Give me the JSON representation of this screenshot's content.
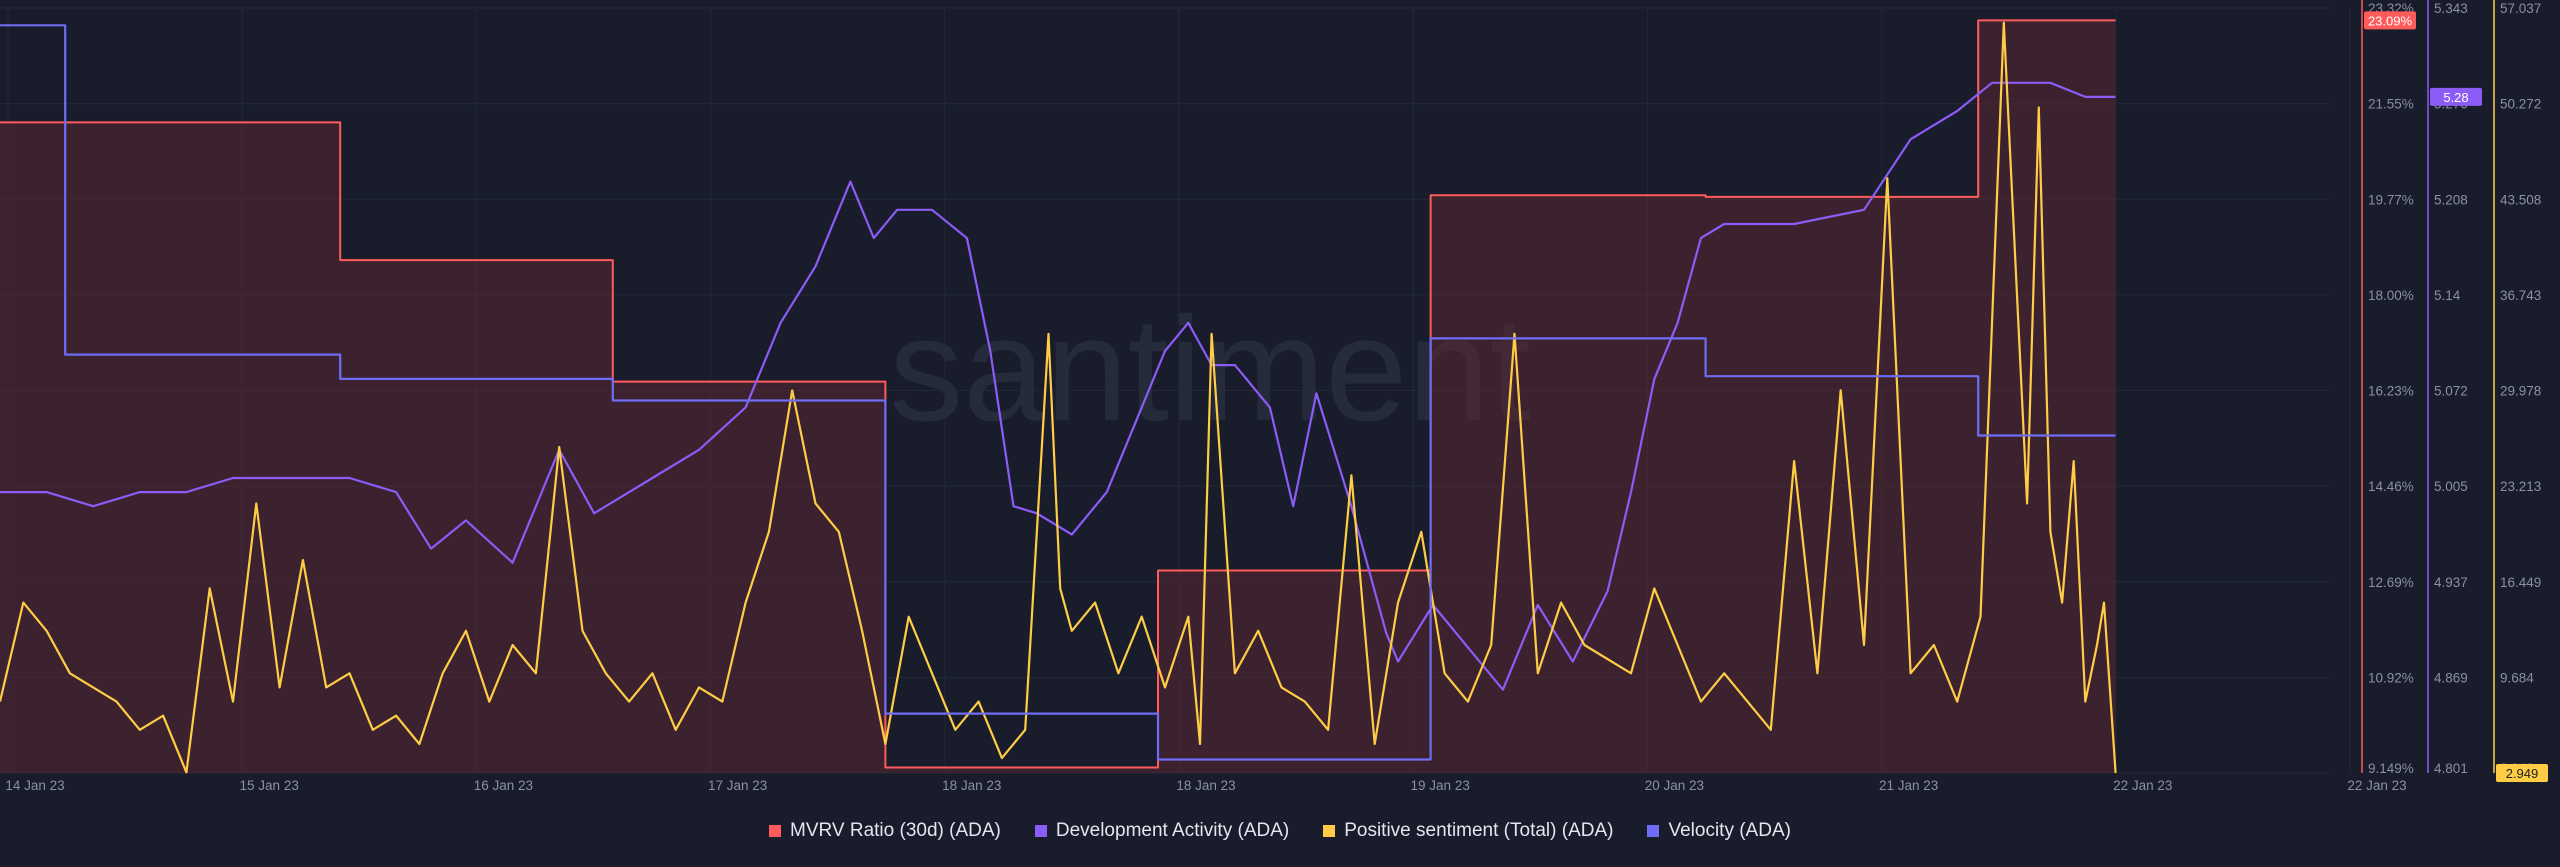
{
  "watermark": "santiment",
  "chart_data": {
    "type": "line",
    "x_labels": [
      "14 Jan 23",
      "15 Jan 23",
      "16 Jan 23",
      "17 Jan 23",
      "18 Jan 23",
      "18 Jan 23",
      "19 Jan 23",
      "20 Jan 23",
      "21 Jan 23",
      "22 Jan 23",
      "22 Jan 23"
    ],
    "axes": {
      "mvrv": {
        "ticks": [
          "23.32%",
          "21.55%",
          "19.77%",
          "18.00%",
          "16.23%",
          "14.46%",
          "12.69%",
          "10.92%",
          "9.149%"
        ],
        "range": [
          9.149,
          23.32
        ],
        "badge": "23.09%",
        "color": "#ff5b5b"
      },
      "dev": {
        "ticks": [
          "5.343",
          "5.276",
          "5.208",
          "5.14",
          "5.072",
          "5.005",
          "4.937",
          "4.869",
          "4.801"
        ],
        "range": [
          4.801,
          5.343
        ],
        "badge": "5.28",
        "color": "#8b5cf6"
      },
      "sent": {
        "ticks": [
          "57.037",
          "50.272",
          "43.508",
          "36.743",
          "29.978",
          "23.213",
          "16.449",
          "9.684",
          "2.949"
        ],
        "range": [
          2.949,
          57.037
        ],
        "badge": "2.949",
        "color": "#ffcd45"
      }
    },
    "series": [
      {
        "name": "MVRV Ratio (30d) (ADA)",
        "color": "#ff5b5b",
        "axis": "mvrv",
        "type": "area",
        "points": [
          [
            0,
            21.2
          ],
          [
            0.146,
            21.2
          ],
          [
            0.146,
            18.65
          ],
          [
            0.263,
            18.65
          ],
          [
            0.263,
            16.4
          ],
          [
            0.38,
            16.4
          ],
          [
            0.38,
            9.25
          ],
          [
            0.497,
            9.25
          ],
          [
            0.497,
            12.9
          ],
          [
            0.614,
            12.9
          ],
          [
            0.614,
            19.85
          ],
          [
            0.732,
            19.85
          ],
          [
            0.732,
            19.82
          ],
          [
            0.849,
            19.82
          ],
          [
            0.849,
            23.09
          ],
          [
            0.908,
            23.09
          ]
        ]
      },
      {
        "name": "Development Activity (ADA)",
        "color": "#8b5cf6",
        "axis": "dev",
        "type": "line",
        "points": [
          [
            0,
            5.0
          ],
          [
            0.02,
            5.0
          ],
          [
            0.04,
            4.99
          ],
          [
            0.06,
            5.0
          ],
          [
            0.08,
            5.0
          ],
          [
            0.1,
            5.01
          ],
          [
            0.13,
            5.01
          ],
          [
            0.15,
            5.01
          ],
          [
            0.17,
            5.0
          ],
          [
            0.185,
            4.96
          ],
          [
            0.2,
            4.98
          ],
          [
            0.22,
            4.95
          ],
          [
            0.24,
            5.03
          ],
          [
            0.255,
            4.985
          ],
          [
            0.28,
            5.01
          ],
          [
            0.3,
            5.03
          ],
          [
            0.32,
            5.06
          ],
          [
            0.335,
            5.12
          ],
          [
            0.35,
            5.16
          ],
          [
            0.365,
            5.22
          ],
          [
            0.375,
            5.18
          ],
          [
            0.385,
            5.2
          ],
          [
            0.4,
            5.2
          ],
          [
            0.415,
            5.18
          ],
          [
            0.425,
            5.1
          ],
          [
            0.435,
            4.99
          ],
          [
            0.445,
            4.985
          ],
          [
            0.46,
            4.97
          ],
          [
            0.475,
            5.0
          ],
          [
            0.49,
            5.06
          ],
          [
            0.5,
            5.1
          ],
          [
            0.51,
            5.12
          ],
          [
            0.52,
            5.09
          ],
          [
            0.53,
            5.09
          ],
          [
            0.545,
            5.06
          ],
          [
            0.555,
            4.99
          ],
          [
            0.565,
            5.07
          ],
          [
            0.58,
            4.99
          ],
          [
            0.595,
            4.9
          ],
          [
            0.6,
            4.88
          ],
          [
            0.615,
            4.92
          ],
          [
            0.63,
            4.89
          ],
          [
            0.645,
            4.86
          ],
          [
            0.66,
            4.92
          ],
          [
            0.675,
            4.88
          ],
          [
            0.69,
            4.93
          ],
          [
            0.7,
            5.0
          ],
          [
            0.71,
            5.08
          ],
          [
            0.72,
            5.12
          ],
          [
            0.73,
            5.18
          ],
          [
            0.74,
            5.19
          ],
          [
            0.77,
            5.19
          ],
          [
            0.8,
            5.2
          ],
          [
            0.82,
            5.25
          ],
          [
            0.84,
            5.27
          ],
          [
            0.855,
            5.29
          ],
          [
            0.88,
            5.29
          ],
          [
            0.895,
            5.28
          ],
          [
            0.908,
            5.28
          ]
        ]
      },
      {
        "name": "Positive sentiment (Total) (ADA)",
        "color": "#ffcd45",
        "axis": "sent",
        "type": "line",
        "points": [
          [
            0,
            8
          ],
          [
            0.01,
            15
          ],
          [
            0.02,
            13
          ],
          [
            0.03,
            10
          ],
          [
            0.05,
            8
          ],
          [
            0.06,
            6
          ],
          [
            0.07,
            7
          ],
          [
            0.08,
            3
          ],
          [
            0.09,
            16
          ],
          [
            0.1,
            8
          ],
          [
            0.11,
            22
          ],
          [
            0.12,
            9
          ],
          [
            0.13,
            18
          ],
          [
            0.14,
            9
          ],
          [
            0.15,
            10
          ],
          [
            0.16,
            6
          ],
          [
            0.17,
            7
          ],
          [
            0.18,
            5
          ],
          [
            0.19,
            10
          ],
          [
            0.2,
            13
          ],
          [
            0.21,
            8
          ],
          [
            0.22,
            12
          ],
          [
            0.23,
            10
          ],
          [
            0.24,
            26
          ],
          [
            0.25,
            13
          ],
          [
            0.26,
            10
          ],
          [
            0.27,
            8
          ],
          [
            0.28,
            10
          ],
          [
            0.29,
            6
          ],
          [
            0.3,
            9
          ],
          [
            0.31,
            8
          ],
          [
            0.32,
            15
          ],
          [
            0.33,
            20
          ],
          [
            0.34,
            30
          ],
          [
            0.35,
            22
          ],
          [
            0.36,
            20
          ],
          [
            0.37,
            13
          ],
          [
            0.38,
            5
          ],
          [
            0.39,
            14
          ],
          [
            0.4,
            10
          ],
          [
            0.41,
            6
          ],
          [
            0.42,
            8
          ],
          [
            0.43,
            4
          ],
          [
            0.44,
            6
          ],
          [
            0.45,
            34
          ],
          [
            0.455,
            16
          ],
          [
            0.46,
            13
          ],
          [
            0.47,
            15
          ],
          [
            0.48,
            10
          ],
          [
            0.49,
            14
          ],
          [
            0.5,
            9
          ],
          [
            0.51,
            14
          ],
          [
            0.515,
            5
          ],
          [
            0.52,
            34
          ],
          [
            0.53,
            10
          ],
          [
            0.54,
            13
          ],
          [
            0.55,
            9
          ],
          [
            0.56,
            8
          ],
          [
            0.57,
            6
          ],
          [
            0.58,
            24
          ],
          [
            0.59,
            5
          ],
          [
            0.6,
            15
          ],
          [
            0.61,
            20
          ],
          [
            0.62,
            10
          ],
          [
            0.63,
            8
          ],
          [
            0.64,
            12
          ],
          [
            0.65,
            34
          ],
          [
            0.66,
            10
          ],
          [
            0.67,
            15
          ],
          [
            0.68,
            12
          ],
          [
            0.7,
            10
          ],
          [
            0.71,
            16
          ],
          [
            0.72,
            12
          ],
          [
            0.73,
            8
          ],
          [
            0.74,
            10
          ],
          [
            0.75,
            8
          ],
          [
            0.76,
            6
          ],
          [
            0.77,
            25
          ],
          [
            0.78,
            10
          ],
          [
            0.79,
            30
          ],
          [
            0.8,
            12
          ],
          [
            0.81,
            45
          ],
          [
            0.82,
            10
          ],
          [
            0.83,
            12
          ],
          [
            0.84,
            8
          ],
          [
            0.85,
            14
          ],
          [
            0.86,
            56
          ],
          [
            0.87,
            22
          ],
          [
            0.875,
            50
          ],
          [
            0.88,
            20
          ],
          [
            0.885,
            15
          ],
          [
            0.89,
            25
          ],
          [
            0.895,
            8
          ],
          [
            0.9,
            12
          ],
          [
            0.903,
            15
          ],
          [
            0.908,
            2.949
          ]
        ]
      },
      {
        "name": "Velocity (ADA)",
        "color": "#6f6cf5",
        "axis": "mvrv",
        "type": "line",
        "points": [
          [
            0,
            23.0
          ],
          [
            0.028,
            23.0
          ],
          [
            0.028,
            16.9
          ],
          [
            0.146,
            16.9
          ],
          [
            0.146,
            16.45
          ],
          [
            0.263,
            16.45
          ],
          [
            0.263,
            16.05
          ],
          [
            0.38,
            16.05
          ],
          [
            0.38,
            10.25
          ],
          [
            0.497,
            10.25
          ],
          [
            0.497,
            9.4
          ],
          [
            0.614,
            9.4
          ],
          [
            0.614,
            17.2
          ],
          [
            0.732,
            17.2
          ],
          [
            0.732,
            16.5
          ],
          [
            0.849,
            16.5
          ],
          [
            0.849,
            15.4
          ],
          [
            0.908,
            15.4
          ]
        ]
      }
    ]
  },
  "legend": [
    {
      "label": "MVRV Ratio (30d) (ADA)",
      "color": "#ff5b5b"
    },
    {
      "label": "Development Activity (ADA)",
      "color": "#8b5cf6"
    },
    {
      "label": "Positive sentiment (Total) (ADA)",
      "color": "#ffcd45"
    },
    {
      "label": "Velocity (ADA)",
      "color": "#6f6cf5"
    }
  ]
}
